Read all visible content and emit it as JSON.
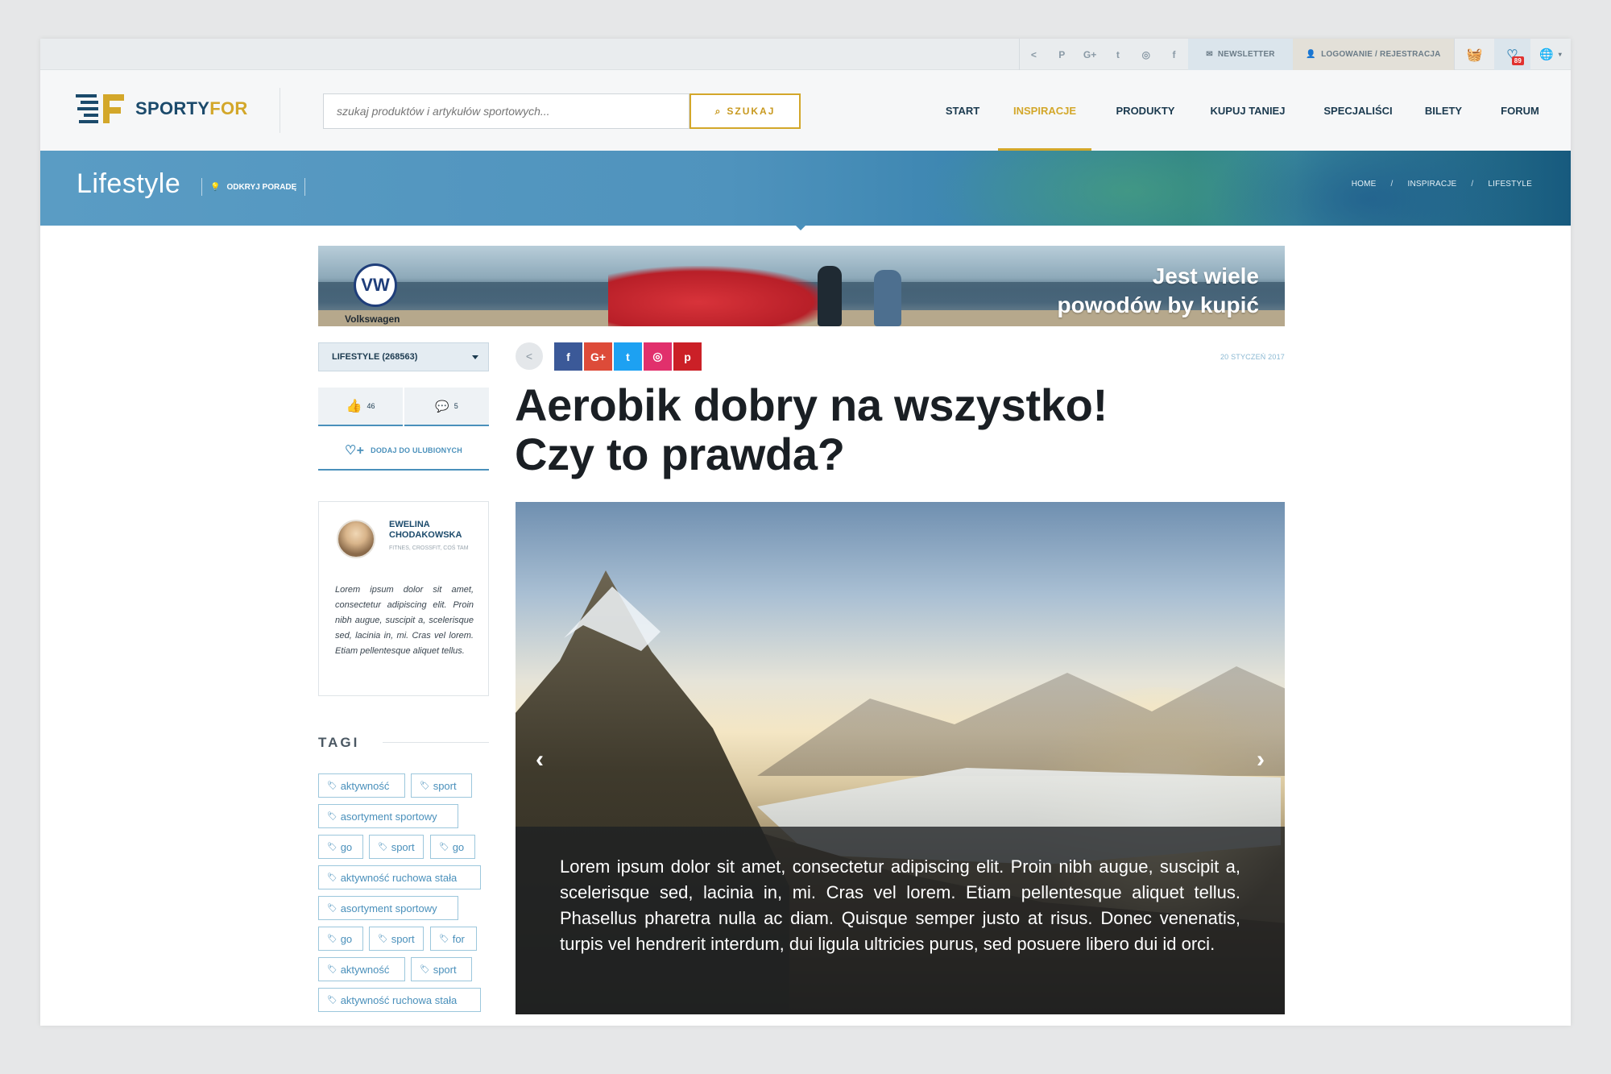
{
  "utilbar": {
    "social_icons": [
      "share-icon",
      "pinterest-icon",
      "google-plus-icon",
      "twitter-icon",
      "instagram-icon",
      "facebook-icon"
    ],
    "newsletter_label": "NEWSLETTER",
    "login_label": "LOGOWANIE / REJESTRACJA",
    "wishlist_count": "89"
  },
  "header": {
    "logo_part1": "SPORTY",
    "logo_part2": "FOR",
    "search_placeholder": "szukaj produktów i artykułów sportowych...",
    "search_button": "SZUKAJ",
    "nav": [
      {
        "label": "START",
        "active": false
      },
      {
        "label": "INSPIRACJE",
        "active": true
      },
      {
        "label": "PRODUKTY",
        "active": false
      },
      {
        "label": "KUPUJ TANIEJ",
        "active": false
      },
      {
        "label": "SPECJALIŚCI",
        "active": false
      },
      {
        "label": "BILETY",
        "active": false
      },
      {
        "label": "FORUM",
        "active": false
      }
    ]
  },
  "banner": {
    "title": "Lifestyle",
    "tip_label": "ODKRYJ PORADĘ",
    "breadcrumb": [
      "HOME",
      "INSPIRACJE",
      "LIFESTYLE"
    ]
  },
  "ad": {
    "brand": "Volkswagen",
    "line1": "Jest wiele",
    "line2": "powodów by kupić"
  },
  "sidebar": {
    "category": "LIFESTYLE",
    "category_count": "(268563)",
    "likes": "46",
    "comments": "5",
    "favorite_label": "DODAJ DO ULUBIONYCH",
    "author": {
      "name": "EWELINA CHODAKOWSKA",
      "specialties": "FITNES, CROSSFIT, COŚ TAM",
      "bio": "Lorem ipsum dolor sit amet, consectetur adipiscing elit. Proin nibh augue, suscipit a, scelerisque sed, lacinia in, mi. Cras vel lorem. Etiam pellentesque aliquet tellus."
    },
    "tags_heading": "TAGI",
    "tags": [
      "aktywność",
      "sport",
      "asortyment sportowy",
      "go",
      "sport",
      "go",
      "aktywność ruchowa stała",
      "asortyment sportowy",
      "go",
      "sport",
      "for",
      "aktywność",
      "sport",
      "aktywność ruchowa stała"
    ]
  },
  "article": {
    "date": "20 STYCZEŃ 2017",
    "share_buttons": [
      {
        "icon": "facebook-icon",
        "glyph": "f",
        "color": "#3b5998"
      },
      {
        "icon": "google-plus-icon",
        "glyph": "G+",
        "color": "#dd4b39"
      },
      {
        "icon": "twitter-icon",
        "glyph": "t",
        "color": "#1da1f2"
      },
      {
        "icon": "instagram-icon",
        "glyph": "◎",
        "color": "#e1306c"
      },
      {
        "icon": "pinterest-icon",
        "glyph": "p",
        "color": "#cb2027"
      }
    ],
    "title_line1": "Aerobik dobry na wszystko!",
    "title_line2": "Czy to prawda?",
    "caption": "Lorem ipsum dolor sit amet, consectetur adipiscing elit. Proin nibh augue, suscipit a, scelerisque sed, lacinia in, mi. Cras vel lorem. Etiam pellentesque aliquet tellus. Phasellus pharetra nulla ac diam. Quisque semper justo at risus. Donec venenatis, turpis vel hendrerit interdum, dui ligula ultricies purus, sed posuere libero dui id orci."
  },
  "colors": {
    "accent_gold": "#d3a72a",
    "brand_blue": "#1b4a6b",
    "banner_blue": "#4f93bd",
    "link_blue": "#4a90bb"
  }
}
